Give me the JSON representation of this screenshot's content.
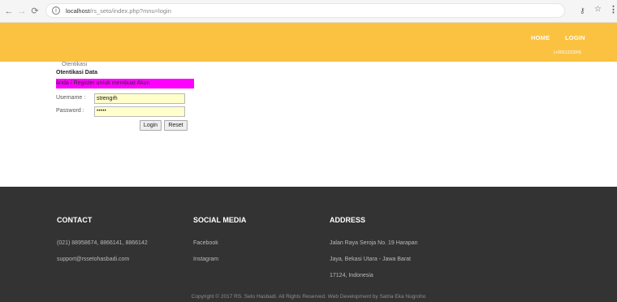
{
  "browser": {
    "url_host": "localhost",
    "url_path": "/rs_seto/index.php?mnu=login"
  },
  "header": {
    "nav": {
      "home": "HOME",
      "login": "LOGIN"
    },
    "phone": "(+001122334)"
  },
  "login": {
    "small_title": "Otentikasi",
    "title": "Otentikasi Data",
    "banner": "n Anda / Register untuk membuat Akun",
    "username_label": "Username :",
    "username_value": "strengrh",
    "password_label": "Password :",
    "password_value": "•••••",
    "login_button": "Login",
    "reset_button": "Reset"
  },
  "footer": {
    "contact": {
      "title": "CONTACT",
      "phones": "(021) 88958674, 8866141, 8866142",
      "email": "support@rssetohasbadi.com"
    },
    "social": {
      "title": "SOCIAL MEDIA",
      "facebook": "Facebook",
      "instagram": "Instagram"
    },
    "address": {
      "title": "ADDRESS",
      "line1": "Jalan Raya Seroja No. 19 Harapan",
      "line2": "Jaya, Bekasi Utara - Jawa Barat",
      "line3": "17124, Indonesia"
    },
    "copyright": "Copyright © 2017 RS. Seto Hasbadi. All Rights Reserved. Web Development by Satria Eka Nugroho"
  },
  "colors": {
    "header_bg": "#fbc241",
    "banner_bg": "#ff00ff",
    "input_bg": "#ffffcc",
    "footer_bg": "#333333"
  },
  "icons": [
    "back-arrow-icon",
    "forward-arrow-icon",
    "reload-icon",
    "info-icon",
    "key-icon",
    "star-icon",
    "menu-icon"
  ]
}
